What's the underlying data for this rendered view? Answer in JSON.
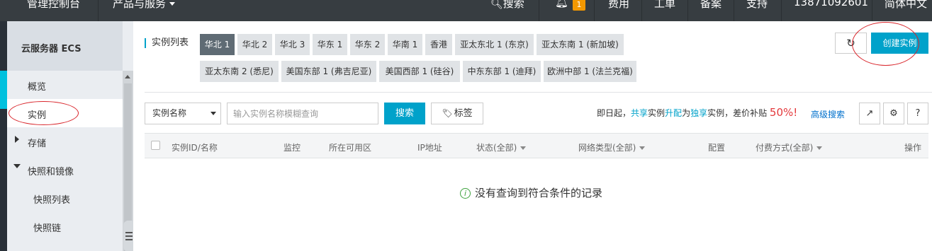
{
  "topbar": {
    "console": "管理控制台",
    "products": "产品与服务",
    "search": "搜索",
    "notifications_count": "1",
    "fees": "费用",
    "tickets": "工单",
    "filing": "备案",
    "support": "支持",
    "account": "13871092601",
    "language": "简体中文"
  },
  "sidebar": {
    "title": "云服务器 ECS",
    "items": [
      {
        "label": "概览"
      },
      {
        "label": "实例"
      },
      {
        "label": "存储"
      },
      {
        "label": "快照和镜像"
      },
      {
        "label": "快照列表"
      },
      {
        "label": "快照链"
      }
    ]
  },
  "main": {
    "title": "实例列表",
    "regions": [
      "华北 1",
      "华北 2",
      "华北 3",
      "华东 1",
      "华东 2",
      "华南 1",
      "香港",
      "亚太东北 1 (东京)",
      "亚太东南 1 (新加坡)",
      "亚太东南 2 (悉尼)",
      "美国东部 1 (弗吉尼亚)",
      "美国西部 1 (硅谷)",
      "中东东部 1 (迪拜)",
      "欧洲中部 1 (法兰克福)"
    ],
    "active_region": "华北 1",
    "create_button": "创建实例",
    "refresh_icon": "refresh-icon",
    "filter": {
      "select_value": "实例名称",
      "placeholder": "输入实例名称模糊查询",
      "search_button": "搜索",
      "tag_button": "标签"
    },
    "promo": {
      "prefix": "即日起，",
      "shared": "共享",
      "mid1": "实例",
      "upgrade": "升配",
      "mid2": "为",
      "exclusive": "独享",
      "mid3": "实例，差价补贴 ",
      "percent": "50%!"
    },
    "advanced_search": "高级搜索",
    "table_headers": {
      "id_name": "实例ID/名称",
      "monitor": "监控",
      "zone": "所在可用区",
      "ip": "IP地址",
      "status": "状态(全部)",
      "network": "网络类型(全部)",
      "config": "配置",
      "billing": "付费方式(全部)",
      "actions": "操作"
    },
    "empty_message": "没有查询到符合条件的记录"
  },
  "colors": {
    "topbar_bg": "#373d41",
    "accent": "#00a2ca",
    "annotation": "#d9252b",
    "active_strip": "#00c1de"
  }
}
